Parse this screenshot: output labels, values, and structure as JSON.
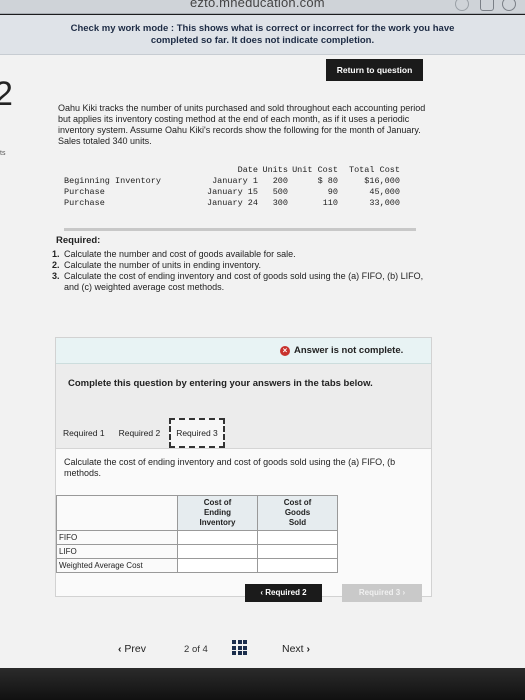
{
  "browser": {
    "url": "ezto.mheducation.com"
  },
  "banner": {
    "line1": "Check my work mode : This shows what is correct or incorrect for the work you have",
    "line2": "completed so far. It does not indicate completion."
  },
  "return_button": "Return to question",
  "question_number": "2",
  "side_fragment": "ts",
  "problem_text": "Oahu Kiki tracks the number of units purchased and sold throughout each accounting period but applies its inventory costing method at the end of each month, as if it uses a periodic inventory system. Assume Oahu Kiki's records show the following for the month of January. Sales totaled 340 units.",
  "data_table": {
    "headers": [
      "",
      "Date",
      "Units",
      "Unit Cost",
      "Total Cost"
    ],
    "rows": [
      [
        "Beginning Inventory",
        "January 1",
        "200",
        "$ 80",
        "$16,000"
      ],
      [
        "Purchase",
        "January 15",
        "500",
        "90",
        "45,000"
      ],
      [
        "Purchase",
        "January 24",
        "300",
        "110",
        "33,000"
      ]
    ]
  },
  "required_heading": "Required:",
  "requirements": [
    {
      "num": "1.",
      "text": "Calculate the number and cost of goods available for sale."
    },
    {
      "num": "2.",
      "text": "Calculate the number of units in ending inventory."
    },
    {
      "num": "3.",
      "text": "Calculate the cost of ending inventory and cost of goods sold using the (a) FIFO, (b) LIFO, and (c) weighted average cost methods."
    }
  ],
  "answer_status": "Answer is not complete.",
  "instruction": "Complete this question by entering your answers in the tabs below.",
  "tabs": [
    {
      "label": "Required 1",
      "active": false
    },
    {
      "label": "Required 2",
      "active": false
    },
    {
      "label": "Required 3",
      "active": true
    }
  ],
  "tab_content": {
    "text": "Calculate the cost of ending inventory and cost of goods sold using the (a) FIFO, (b",
    "text2": "methods.",
    "columns": [
      "Cost of Ending Inventory",
      "Cost of Goods Sold"
    ],
    "col1_lines": [
      "Cost of",
      "Ending",
      "Inventory"
    ],
    "col2_lines": [
      "Cost of",
      "Goods",
      "Sold"
    ],
    "rows": [
      {
        "label": "FIFO",
        "ending": "",
        "cogs": ""
      },
      {
        "label": "LIFO",
        "ending": "",
        "cogs": ""
      },
      {
        "label": "Weighted Average Cost",
        "ending": "",
        "cogs": ""
      }
    ]
  },
  "nav_buttons": {
    "prev_required": "Required 2",
    "next_required": "Required 3"
  },
  "bottom_nav": {
    "prev": "Prev",
    "page_current": "2",
    "page_of": "of",
    "page_total": "4",
    "next": "Next"
  },
  "colors": {
    "status_error": "#c8322d",
    "button_dark": "#1b1b1b",
    "grid_icon": "#1b2d4c"
  }
}
